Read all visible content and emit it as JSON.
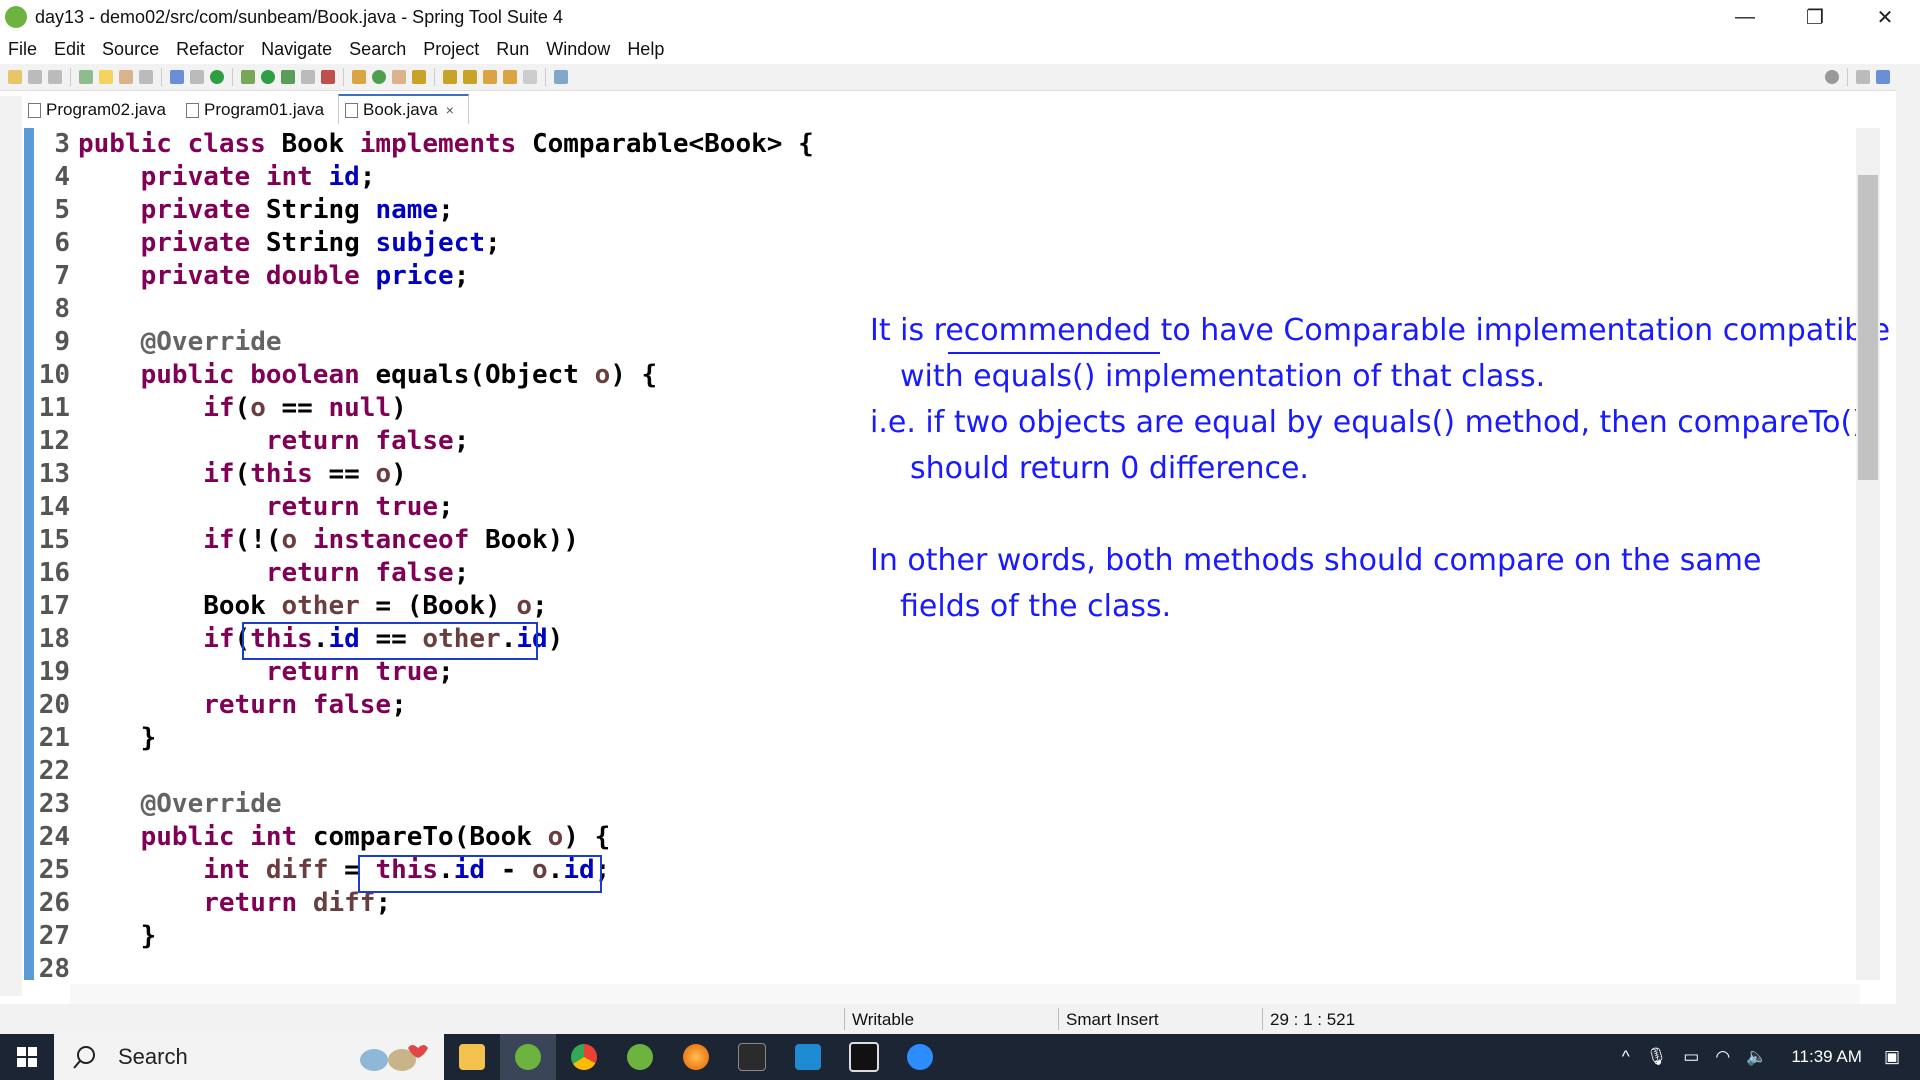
{
  "window": {
    "title": "day13 - demo02/src/com/sunbeam/Book.java - Spring Tool Suite 4",
    "minimize": "—",
    "restore": "❐",
    "close": "✕"
  },
  "menu": [
    "File",
    "Edit",
    "Source",
    "Refactor",
    "Navigate",
    "Search",
    "Project",
    "Run",
    "Window",
    "Help"
  ],
  "tabs": [
    {
      "label": "Program02.java",
      "active": false
    },
    {
      "label": "Program01.java",
      "active": false
    },
    {
      "label": "Book.java",
      "active": true,
      "close": "×"
    }
  ],
  "code_lines": [
    {
      "n": "3",
      "segs": [
        [
          "kw",
          "public class "
        ],
        [
          "plain",
          "Book "
        ],
        [
          "kw",
          "implements "
        ],
        [
          "plain",
          "Comparable<Book> {"
        ]
      ]
    },
    {
      "n": "4",
      "segs": [
        [
          "plain",
          "    "
        ],
        [
          "kw",
          "private int "
        ],
        [
          "fld",
          "id"
        ],
        [
          "plain",
          ";"
        ]
      ]
    },
    {
      "n": "5",
      "segs": [
        [
          "plain",
          "    "
        ],
        [
          "kw",
          "private "
        ],
        [
          "plain",
          "String "
        ],
        [
          "fld",
          "name"
        ],
        [
          "plain",
          ";"
        ]
      ]
    },
    {
      "n": "6",
      "segs": [
        [
          "plain",
          "    "
        ],
        [
          "kw",
          "private "
        ],
        [
          "plain",
          "String "
        ],
        [
          "fld",
          "subject"
        ],
        [
          "plain",
          ";"
        ]
      ]
    },
    {
      "n": "7",
      "segs": [
        [
          "plain",
          "    "
        ],
        [
          "kw",
          "private double "
        ],
        [
          "fld",
          "price"
        ],
        [
          "plain",
          ";"
        ]
      ]
    },
    {
      "n": "8",
      "segs": []
    },
    {
      "n": "9",
      "segs": [
        [
          "plain",
          "    "
        ],
        [
          "ann",
          "@Override"
        ]
      ]
    },
    {
      "n": "10",
      "segs": [
        [
          "plain",
          "    "
        ],
        [
          "kw",
          "public boolean "
        ],
        [
          "plain",
          "equals(Object "
        ],
        [
          "var",
          "o"
        ],
        [
          "plain",
          ") {"
        ]
      ]
    },
    {
      "n": "11",
      "segs": [
        [
          "plain",
          "        "
        ],
        [
          "kw",
          "if"
        ],
        [
          "plain",
          "("
        ],
        [
          "var",
          "o"
        ],
        [
          "plain",
          " == "
        ],
        [
          "kw",
          "null"
        ],
        [
          "plain",
          ")"
        ]
      ]
    },
    {
      "n": "12",
      "segs": [
        [
          "plain",
          "            "
        ],
        [
          "kw",
          "return false"
        ],
        [
          "plain",
          ";"
        ]
      ]
    },
    {
      "n": "13",
      "segs": [
        [
          "plain",
          "        "
        ],
        [
          "kw",
          "if"
        ],
        [
          "plain",
          "("
        ],
        [
          "kw",
          "this"
        ],
        [
          "plain",
          " == "
        ],
        [
          "var",
          "o"
        ],
        [
          "plain",
          ")"
        ]
      ]
    },
    {
      "n": "14",
      "segs": [
        [
          "plain",
          "            "
        ],
        [
          "kw",
          "return true"
        ],
        [
          "plain",
          ";"
        ]
      ]
    },
    {
      "n": "15",
      "segs": [
        [
          "plain",
          "        "
        ],
        [
          "kw",
          "if"
        ],
        [
          "plain",
          "(!("
        ],
        [
          "var",
          "o "
        ],
        [
          "kw",
          "instanceof "
        ],
        [
          "plain",
          "Book))"
        ]
      ]
    },
    {
      "n": "16",
      "segs": [
        [
          "plain",
          "            "
        ],
        [
          "kw",
          "return false"
        ],
        [
          "plain",
          ";"
        ]
      ]
    },
    {
      "n": "17",
      "segs": [
        [
          "plain",
          "        Book "
        ],
        [
          "var",
          "other"
        ],
        [
          "plain",
          " = (Book) "
        ],
        [
          "var",
          "o"
        ],
        [
          "plain",
          ";"
        ]
      ]
    },
    {
      "n": "18",
      "segs": [
        [
          "plain",
          "        "
        ],
        [
          "kw",
          "if"
        ],
        [
          "plain",
          "("
        ],
        [
          "kw",
          "this"
        ],
        [
          "plain",
          "."
        ],
        [
          "fld",
          "id"
        ],
        [
          "plain",
          " == "
        ],
        [
          "var",
          "other"
        ],
        [
          "plain",
          "."
        ],
        [
          "fld",
          "id"
        ],
        [
          "plain",
          ")"
        ]
      ]
    },
    {
      "n": "19",
      "segs": [
        [
          "plain",
          "            "
        ],
        [
          "kw",
          "return true"
        ],
        [
          "plain",
          ";"
        ]
      ]
    },
    {
      "n": "20",
      "segs": [
        [
          "plain",
          "        "
        ],
        [
          "kw",
          "return false"
        ],
        [
          "plain",
          ";"
        ]
      ]
    },
    {
      "n": "21",
      "segs": [
        [
          "plain",
          "    }"
        ]
      ]
    },
    {
      "n": "22",
      "segs": []
    },
    {
      "n": "23",
      "segs": [
        [
          "plain",
          "    "
        ],
        [
          "ann",
          "@Override"
        ]
      ]
    },
    {
      "n": "24",
      "segs": [
        [
          "plain",
          "    "
        ],
        [
          "kw",
          "public int "
        ],
        [
          "plain",
          "compareTo(Book "
        ],
        [
          "var",
          "o"
        ],
        [
          "plain",
          ") {"
        ]
      ]
    },
    {
      "n": "25",
      "segs": [
        [
          "plain",
          "        "
        ],
        [
          "kw",
          "int "
        ],
        [
          "var",
          "diff"
        ],
        [
          "plain",
          " = "
        ],
        [
          "kw",
          "this"
        ],
        [
          "plain",
          "."
        ],
        [
          "fld",
          "id"
        ],
        [
          "plain",
          " - "
        ],
        [
          "var",
          "o"
        ],
        [
          "plain",
          "."
        ],
        [
          "fld",
          "id"
        ],
        [
          "plain",
          ";"
        ]
      ]
    },
    {
      "n": "26",
      "segs": [
        [
          "plain",
          "        "
        ],
        [
          "kw",
          "return "
        ],
        [
          "var",
          "diff"
        ],
        [
          "plain",
          ";"
        ]
      ]
    },
    {
      "n": "27",
      "segs": [
        [
          "plain",
          "    }"
        ]
      ]
    },
    {
      "n": "28",
      "segs": []
    }
  ],
  "annotation": {
    "line1": "It is recommended to have Comparable implementation compatible",
    "line2": "with equals() implementation of that class.",
    "line3": "i.e. if two objects are equal by equals() method, then compareTo()",
    "line4": "should return 0 difference.",
    "line5": "In other words, both methods should compare on the same",
    "line6": "fields of the class."
  },
  "status": {
    "writable": "Writable",
    "insert_mode": "Smart Insert",
    "position": "29 : 1 : 521"
  },
  "taskbar": {
    "search_placeholder": "Search",
    "clock": "11:39 AM",
    "apps": [
      "file-explorer",
      "spring-tool-suite",
      "chrome",
      "spring-tool-suite-2",
      "firefox",
      "terminal",
      "vscode",
      "app-window",
      "zoom"
    ]
  },
  "colors": {
    "keyword": "#7f0055",
    "field": "#0000c0",
    "local_var": "#6a3e3e",
    "annotation": "#646464",
    "handwriting": "#1a1aff",
    "highlight_box": "#1a3ccf"
  }
}
